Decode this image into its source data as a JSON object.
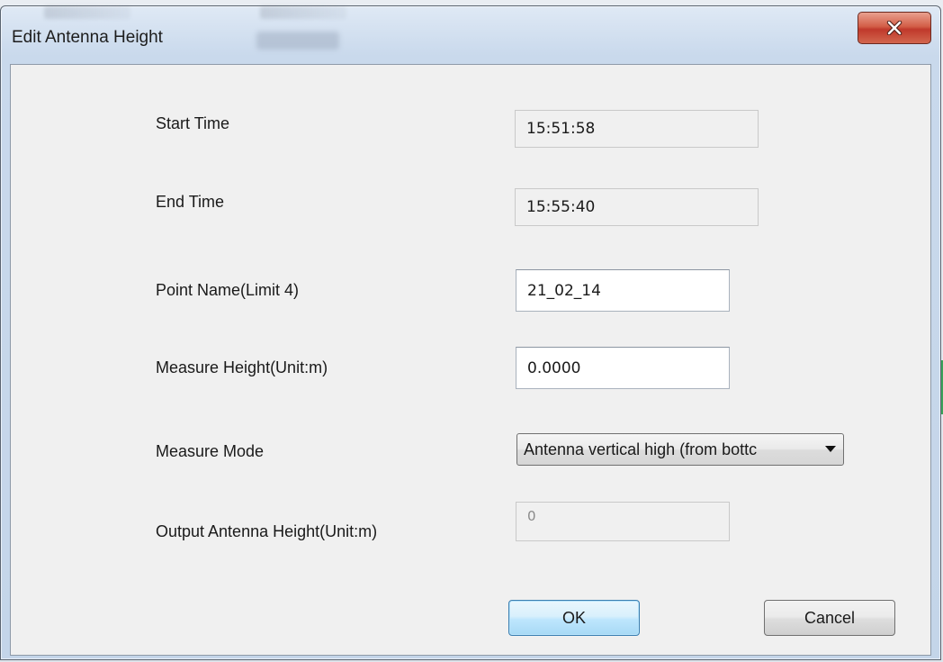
{
  "window": {
    "title": "Edit Antenna Height"
  },
  "form": {
    "start_time": {
      "label": "Start Time",
      "value": "15:51:58"
    },
    "end_time": {
      "label": "End Time",
      "value": "15:55:40"
    },
    "point_name": {
      "label": "Point Name(Limit 4)",
      "value": "21_02_14"
    },
    "measure_height": {
      "label": "Measure Height(Unit:m)",
      "value": "0.0000"
    },
    "measure_mode": {
      "label": "Measure Mode",
      "selected": "Antenna vertical high (from bottc"
    },
    "output_height": {
      "label": "Output Antenna Height(Unit:m)",
      "value": "0"
    }
  },
  "buttons": {
    "ok_label": "OK",
    "cancel_label": "Cancel"
  },
  "icons": {
    "close": "close-icon",
    "dropdown": "chevron-down-icon"
  },
  "colors": {
    "close_button": "#c9523c",
    "ok_button_border": "#3c7fb1",
    "dialog_background": "#f0f0f0"
  }
}
